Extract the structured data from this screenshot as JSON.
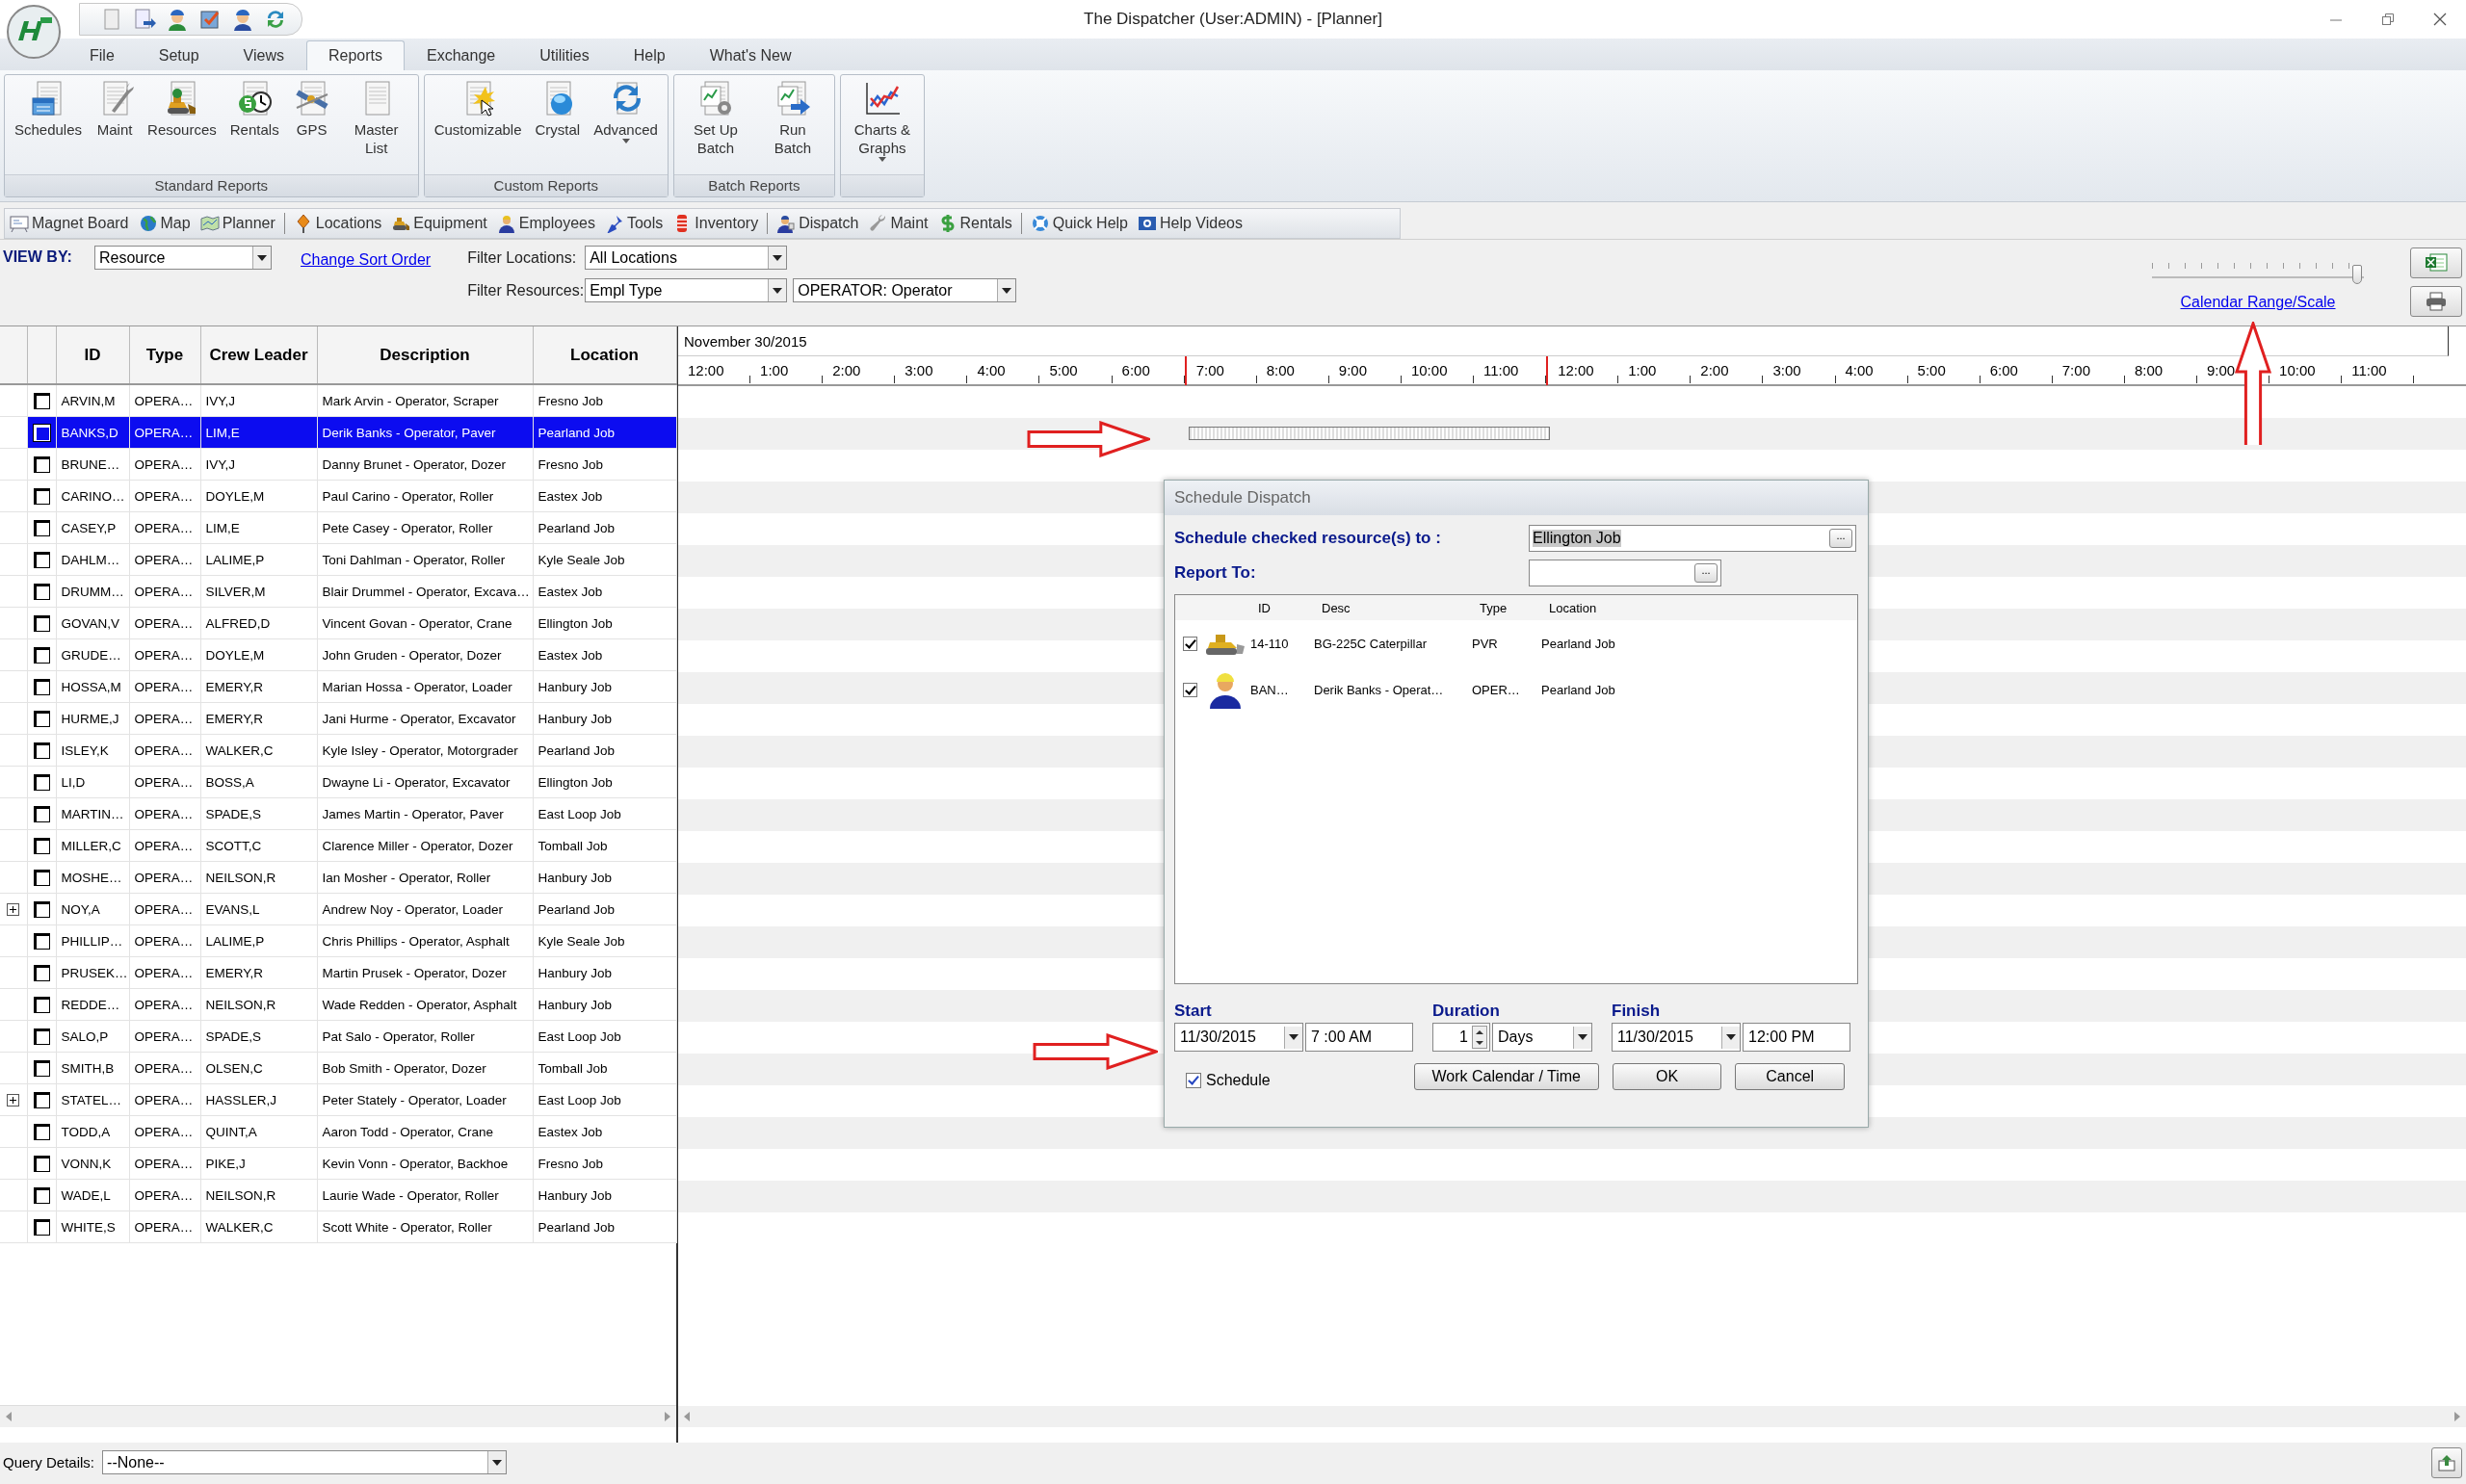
{
  "window": {
    "title": "The Dispatcher (User:ADMIN) - [Planner]"
  },
  "menu_tabs": [
    {
      "label": "File",
      "selected": false
    },
    {
      "label": "Setup",
      "selected": false
    },
    {
      "label": "Views",
      "selected": false
    },
    {
      "label": "Reports",
      "selected": true
    },
    {
      "label": "Exchange",
      "selected": false
    },
    {
      "label": "Utilities",
      "selected": false
    },
    {
      "label": "Help",
      "selected": false
    },
    {
      "label": "What's New",
      "selected": false
    }
  ],
  "ribbon": {
    "groups": [
      {
        "title": "Standard Reports",
        "buttons": [
          {
            "label": "Schedules",
            "dropdown": false
          },
          {
            "label": "Maint",
            "dropdown": false
          },
          {
            "label": "Resources",
            "dropdown": false
          },
          {
            "label": "Rentals",
            "dropdown": false
          },
          {
            "label": "GPS",
            "dropdown": false
          },
          {
            "label": "Master List",
            "dropdown": false
          }
        ]
      },
      {
        "title": "Custom Reports",
        "buttons": [
          {
            "label": "Customizable",
            "dropdown": false
          },
          {
            "label": "Crystal",
            "dropdown": false
          },
          {
            "label": "Advanced",
            "dropdown": true
          }
        ]
      },
      {
        "title": "Batch Reports",
        "buttons": [
          {
            "label": "Set Up Batch",
            "dropdown": false
          },
          {
            "label": "Run Batch",
            "dropdown": false
          }
        ]
      },
      {
        "buttons": [
          {
            "label": "Charts & Graphs",
            "dropdown": true
          }
        ]
      }
    ]
  },
  "toolbar": {
    "groups": [
      {
        "items": [
          "Magnet Board",
          "Map",
          "Planner"
        ]
      },
      {
        "items": [
          "Locations",
          "Equipment",
          "Employees",
          "Tools",
          "Inventory"
        ]
      },
      {
        "items": [
          "Dispatch",
          "Maint",
          "Rentals"
        ]
      },
      {
        "items": [
          "Quick Help",
          "Help Videos"
        ]
      }
    ]
  },
  "filters": {
    "view_by_label": "VIEW BY:",
    "view_by": "Resource",
    "sort_link": "Change Sort Order",
    "locations_label": "Filter Locations:",
    "locations": "All Locations",
    "resources_label": "Filter Resources:",
    "resource_type": "Empl Type",
    "resource_value": "OPERATOR: Operator"
  },
  "scale": {
    "level": 0.97,
    "link": "Calendar Range/Scale"
  },
  "grid": {
    "columns": [
      "ID",
      "Type",
      "Crew Leader",
      "Description",
      "Location"
    ],
    "rows": [
      {
        "id": "ARVIN,M",
        "type": "OPERA…",
        "crew_leader": "IVY,J",
        "description": "Mark Arvin - Operator, Scraper",
        "location": "Fresno Job",
        "checked": false,
        "selected": false,
        "expandable": false,
        "pending_bar": false
      },
      {
        "id": "BANKS,D",
        "type": "OPERA…",
        "crew_leader": "LIM,E",
        "description": "Derik Banks - Operator, Paver",
        "location": "Pearland Job",
        "checked": false,
        "selected": true,
        "expandable": false,
        "pending_bar": true
      },
      {
        "id": "BRUNE…",
        "type": "OPERA…",
        "crew_leader": "IVY,J",
        "description": "Danny Brunet - Operator, Dozer",
        "location": "Fresno Job",
        "checked": false,
        "selected": false,
        "expandable": false,
        "pending_bar": false
      },
      {
        "id": "CARINO…",
        "type": "OPERA…",
        "crew_leader": "DOYLE,M",
        "description": "Paul Carino - Operator, Roller",
        "location": "Eastex Job",
        "checked": false,
        "selected": false,
        "expandable": false,
        "pending_bar": false
      },
      {
        "id": "CASEY,P",
        "type": "OPERA…",
        "crew_leader": "LIM,E",
        "description": "Pete Casey - Operator, Roller",
        "location": "Pearland Job",
        "checked": false,
        "selected": false,
        "expandable": false,
        "pending_bar": false
      },
      {
        "id": "DAHLM…",
        "type": "OPERA…",
        "crew_leader": "LALIME,P",
        "description": "Toni Dahlman - Operator, Roller",
        "location": "Kyle Seale Job",
        "checked": false,
        "selected": false,
        "expandable": false,
        "pending_bar": false
      },
      {
        "id": "DRUMM…",
        "type": "OPERA…",
        "crew_leader": "SILVER,M",
        "description": "Blair Drummel - Operator, Excava…",
        "location": "Eastex Job",
        "checked": false,
        "selected": false,
        "expandable": false,
        "pending_bar": false
      },
      {
        "id": "GOVAN,V",
        "type": "OPERA…",
        "crew_leader": "ALFRED,D",
        "description": "Vincent Govan - Operator, Crane",
        "location": "Ellington Job",
        "checked": false,
        "selected": false,
        "expandable": false,
        "pending_bar": false
      },
      {
        "id": "GRUDE…",
        "type": "OPERA…",
        "crew_leader": "DOYLE,M",
        "description": "John Gruden - Operator, Dozer",
        "location": "Eastex Job",
        "checked": false,
        "selected": false,
        "expandable": false,
        "pending_bar": false
      },
      {
        "id": "HOSSA,M",
        "type": "OPERA…",
        "crew_leader": "EMERY,R",
        "description": "Marian Hossa - Operator, Loader",
        "location": "Hanbury Job",
        "checked": false,
        "selected": false,
        "expandable": false,
        "pending_bar": false
      },
      {
        "id": "HURME,J",
        "type": "OPERA…",
        "crew_leader": "EMERY,R",
        "description": "Jani Hurme - Operator, Excavator",
        "location": "Hanbury Job",
        "checked": false,
        "selected": false,
        "expandable": false,
        "pending_bar": false
      },
      {
        "id": "ISLEY,K",
        "type": "OPERA…",
        "crew_leader": "WALKER,C",
        "description": "Kyle Isley - Operator, Motorgrader",
        "location": "Pearland Job",
        "checked": false,
        "selected": false,
        "expandable": false,
        "pending_bar": false
      },
      {
        "id": "LI,D",
        "type": "OPERA…",
        "crew_leader": "BOSS,A",
        "description": "Dwayne Li - Operator, Excavator",
        "location": "Ellington Job",
        "checked": false,
        "selected": false,
        "expandable": false,
        "pending_bar": false
      },
      {
        "id": "MARTIN…",
        "type": "OPERA…",
        "crew_leader": "SPADE,S",
        "description": "James Martin - Operator, Paver",
        "location": "East Loop Job",
        "checked": false,
        "selected": false,
        "expandable": false,
        "pending_bar": false
      },
      {
        "id": "MILLER,C",
        "type": "OPERA…",
        "crew_leader": "SCOTT,C",
        "description": "Clarence Miller - Operator, Dozer",
        "location": "Tomball Job",
        "checked": false,
        "selected": false,
        "expandable": false,
        "pending_bar": false
      },
      {
        "id": "MOSHE…",
        "type": "OPERA…",
        "crew_leader": "NEILSON,R",
        "description": "Ian Mosher - Operator, Roller",
        "location": "Hanbury Job",
        "checked": false,
        "selected": false,
        "expandable": false,
        "pending_bar": false
      },
      {
        "id": "NOY,A",
        "type": "OPERA…",
        "crew_leader": "EVANS,L",
        "description": "Andrew Noy - Operator, Loader",
        "location": "Pearland Job",
        "checked": false,
        "selected": false,
        "expandable": true,
        "pending_bar": false
      },
      {
        "id": "PHILLIP…",
        "type": "OPERA…",
        "crew_leader": "LALIME,P",
        "description": "Chris Phillips - Operator, Asphalt",
        "location": "Kyle Seale Job",
        "checked": false,
        "selected": false,
        "expandable": false,
        "pending_bar": false
      },
      {
        "id": "PRUSEK…",
        "type": "OPERA…",
        "crew_leader": "EMERY,R",
        "description": "Martin Prusek - Operator, Dozer",
        "location": "Hanbury Job",
        "checked": false,
        "selected": false,
        "expandable": false,
        "pending_bar": false
      },
      {
        "id": "REDDE…",
        "type": "OPERA…",
        "crew_leader": "NEILSON,R",
        "description": "Wade Redden - Operator, Asphalt",
        "location": "Hanbury Job",
        "checked": false,
        "selected": false,
        "expandable": false,
        "pending_bar": false
      },
      {
        "id": "SALO,P",
        "type": "OPERA…",
        "crew_leader": "SPADE,S",
        "description": "Pat Salo - Operator, Roller",
        "location": "East Loop Job",
        "checked": false,
        "selected": false,
        "expandable": false,
        "pending_bar": false
      },
      {
        "id": "SMITH,B",
        "type": "OPERA…",
        "crew_leader": "OLSEN,C",
        "description": "Bob Smith - Operator, Dozer",
        "location": "Tomball Job",
        "checked": false,
        "selected": false,
        "expandable": false,
        "pending_bar": false
      },
      {
        "id": "STATEL…",
        "type": "OPERA…",
        "crew_leader": "HASSLER,J",
        "description": "Peter Stately - Operator, Loader",
        "location": "East Loop Job",
        "checked": false,
        "selected": false,
        "expandable": true,
        "pending_bar": false
      },
      {
        "id": "TODD,A",
        "type": "OPERA…",
        "crew_leader": "QUINT,A",
        "description": "Aaron Todd - Operator, Crane",
        "location": "Eastex Job",
        "checked": false,
        "selected": false,
        "expandable": false,
        "pending_bar": false
      },
      {
        "id": "VONN,K",
        "type": "OPERA…",
        "crew_leader": "PIKE,J",
        "description": "Kevin Vonn - Operator, Backhoe",
        "location": "Fresno Job",
        "checked": false,
        "selected": false,
        "expandable": false,
        "pending_bar": false
      },
      {
        "id": "WADE,L",
        "type": "OPERA…",
        "crew_leader": "NEILSON,R",
        "description": "Laurie Wade - Operator, Roller",
        "location": "Hanbury Job",
        "checked": false,
        "selected": false,
        "expandable": false,
        "pending_bar": false
      },
      {
        "id": "WHITE,S",
        "type": "OPERA…",
        "crew_leader": "WALKER,C",
        "description": "Scott White - Operator, Roller",
        "location": "Pearland Job",
        "checked": false,
        "selected": false,
        "expandable": false,
        "pending_bar": false
      }
    ]
  },
  "timeline": {
    "date": "November 30/2015",
    "hours": [
      {
        "label": "12:00",
        "marked": false
      },
      {
        "label": "1:00",
        "marked": false
      },
      {
        "label": "2:00",
        "marked": false
      },
      {
        "label": "3:00",
        "marked": false
      },
      {
        "label": "4:00",
        "marked": false
      },
      {
        "label": "5:00",
        "marked": false
      },
      {
        "label": "6:00",
        "marked": false
      },
      {
        "label": "7:00",
        "marked": true
      },
      {
        "label": "8:00",
        "marked": false
      },
      {
        "label": "9:00",
        "marked": false
      },
      {
        "label": "10:00",
        "marked": false
      },
      {
        "label": "11:00",
        "marked": false
      },
      {
        "label": "12:00",
        "marked": true
      },
      {
        "label": "1:00",
        "marked": false
      },
      {
        "label": "2:00",
        "marked": false
      },
      {
        "label": "3:00",
        "marked": false
      },
      {
        "label": "4:00",
        "marked": false
      },
      {
        "label": "5:00",
        "marked": false
      },
      {
        "label": "6:00",
        "marked": false
      },
      {
        "label": "7:00",
        "marked": false
      },
      {
        "label": "8:00",
        "marked": false
      },
      {
        "label": "9:00",
        "marked": false
      },
      {
        "label": "10:00",
        "marked": false
      },
      {
        "label": "11:00",
        "marked": false
      }
    ]
  },
  "dialog": {
    "title": "Schedule Dispatch",
    "target_label": "Schedule checked resource(s) to :",
    "target_value": "Ellington Job",
    "target_browse": "...",
    "report_label": "Report To:",
    "report_browse": "...",
    "columns": [
      "ID",
      "Desc",
      "Type",
      "Location"
    ],
    "items": [
      {
        "kind": "equipment",
        "checked": true,
        "id": "14-110",
        "desc": "BG-225C Caterpillar",
        "type": "PVR",
        "location": "Pearland Job"
      },
      {
        "kind": "person",
        "checked": true,
        "id": "BAN…",
        "desc": "Derik Banks - Operat…",
        "type": "OPER…",
        "location": "Pearland Job"
      }
    ],
    "start_label": "Start",
    "start_date": "11/30/2015",
    "start_time": "7 :00 AM",
    "duration_label": "Duration",
    "duration": "1",
    "duration_unit": "Days",
    "finish_label": "Finish",
    "finish_date": "11/30/2015",
    "finish_time": "12:00 PM",
    "schedule_label": "Schedule",
    "schedule_checked": true,
    "buttons": [
      "Work Calendar / Time",
      "OK",
      "Cancel"
    ]
  },
  "query": {
    "label": "Query Details:",
    "value": "--None--"
  }
}
